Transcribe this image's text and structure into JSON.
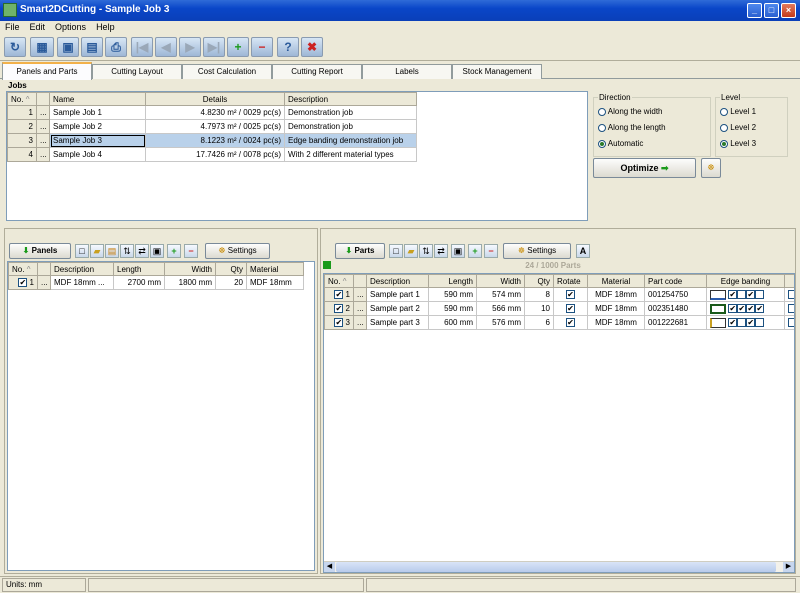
{
  "window": {
    "title": "Smart2DCutting - Sample Job 3"
  },
  "menu": [
    "File",
    "Edit",
    "Options",
    "Help"
  ],
  "tabs": [
    "Panels and Parts",
    "Cutting Layout",
    "Cost Calculation",
    "Cutting Report",
    "Labels",
    "Stock Management"
  ],
  "jobs": {
    "heading": "Jobs",
    "columns": [
      "No.",
      "Name",
      "Details",
      "Description"
    ],
    "rows": [
      {
        "no": "1",
        "name": "Sample Job 1",
        "details": "4.8230 m² / 0029 pc(s)",
        "description": "Demonstration job"
      },
      {
        "no": "2",
        "name": "Sample Job 2",
        "details": "4.7973 m² / 0025 pc(s)",
        "description": "Demonstration job"
      },
      {
        "no": "3",
        "name": "Sample Job 3",
        "details": "8.1223 m² / 0024 pc(s)",
        "description": "Edge banding demonstration job"
      },
      {
        "no": "4",
        "name": "Sample Job 4",
        "details": "17.7426 m² / 0078 pc(s)",
        "description": "With 2 different material types"
      }
    ]
  },
  "direction": {
    "label": "Direction",
    "options": [
      "Along the width",
      "Along the length",
      "Automatic"
    ],
    "selected": 2
  },
  "level": {
    "label": "Level",
    "options": [
      "Level 1",
      "Level 2",
      "Level 3"
    ],
    "selected": 2
  },
  "optimize": {
    "label": "Optimize"
  },
  "panels": {
    "button": "Panels",
    "settings": "Settings",
    "columns": [
      "No.",
      "Description",
      "Length",
      "Width",
      "Qty",
      "Material"
    ],
    "rows": [
      {
        "no": "1",
        "description": "MDF 18mm ...",
        "length": "2700 mm",
        "width": "1800 mm",
        "qty": "20",
        "material": "MDF 18mm"
      }
    ]
  },
  "parts": {
    "button": "Parts",
    "settings": "Settings",
    "counter": "24 / 1000 Parts",
    "columns": [
      "No.",
      "Description",
      "Length",
      "Width",
      "Qty",
      "Rotate",
      "Material",
      "Part code",
      "Edge banding"
    ],
    "rows": [
      {
        "no": "1",
        "description": "Sample part 1",
        "length": "590 mm",
        "width": "574 mm",
        "qty": "8",
        "material": "MDF 18mm",
        "code": "001254750"
      },
      {
        "no": "2",
        "description": "Sample part 2",
        "length": "590 mm",
        "width": "566 mm",
        "qty": "10",
        "material": "MDF 18mm",
        "code": "002351480"
      },
      {
        "no": "3",
        "description": "Sample part 3",
        "length": "600 mm",
        "width": "576 mm",
        "qty": "6",
        "material": "MDF 18mm",
        "code": "001222681"
      }
    ]
  },
  "status": {
    "units": "Units: mm"
  }
}
